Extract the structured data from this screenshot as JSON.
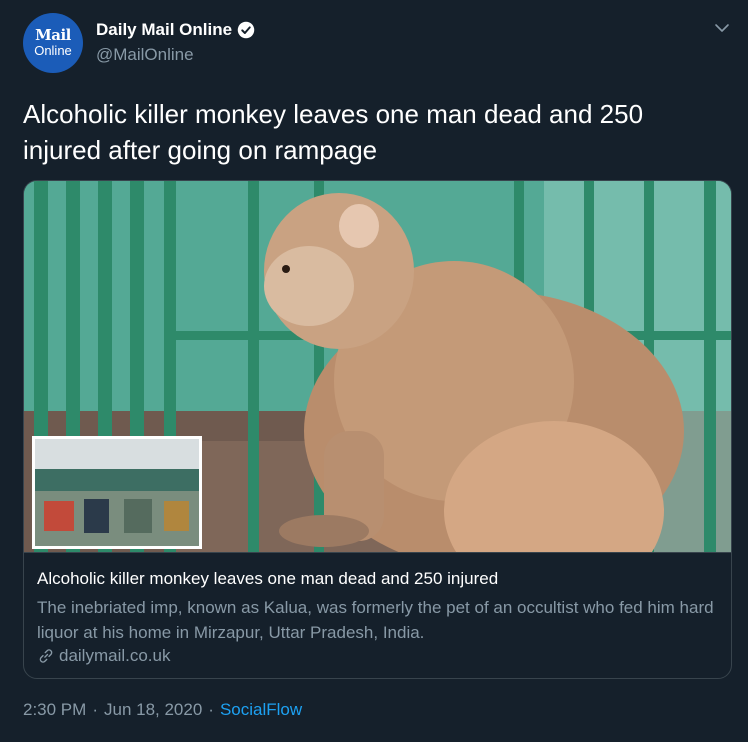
{
  "account": {
    "avatar_line1": "Mail",
    "avatar_line2": "Online",
    "display_name": "Daily Mail Online",
    "handle": "@MailOnline",
    "verified_icon": "verified-badge-icon"
  },
  "tweet": {
    "text": "Alcoholic killer monkey leaves one man dead and 250 injured after going on rampage"
  },
  "card": {
    "title": "Alcoholic killer monkey leaves one man dead and 250 injured",
    "description": "The inebriated imp, known as Kalua, was formerly the pet of an occultist who fed him hard liquor at his home in Mirzapur, Uttar Pradesh, India.",
    "domain": "dailymail.co.uk"
  },
  "footer": {
    "time": "2:30 PM",
    "separator": "·",
    "date": "Jun 18, 2020",
    "source": "SocialFlow"
  },
  "colors": {
    "background": "#15202b",
    "secondary_text": "#8899a6",
    "link": "#1da1f2",
    "border": "#38444d"
  }
}
